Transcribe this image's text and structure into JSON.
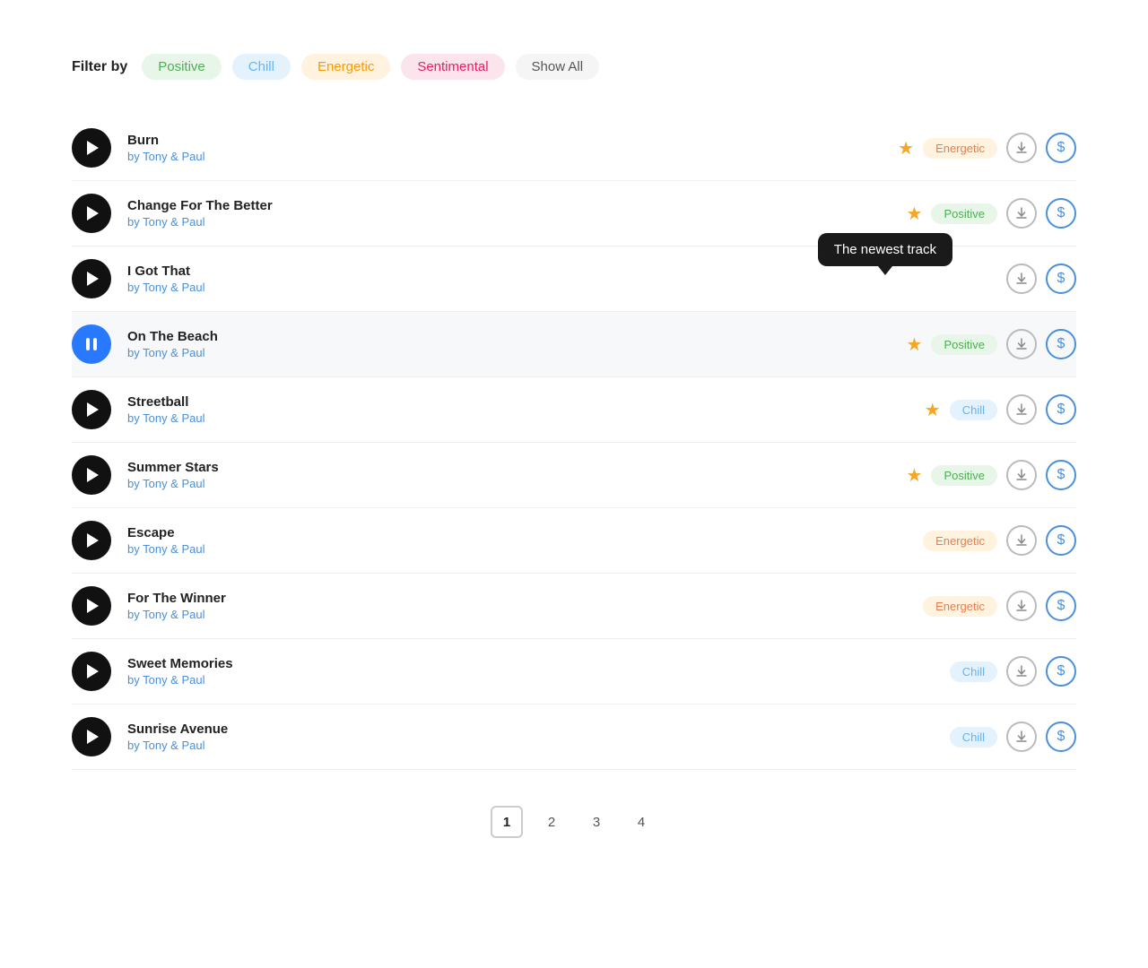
{
  "filter_bar": {
    "label": "Filter by",
    "chips": [
      {
        "id": "positive",
        "label": "Positive",
        "class": "chip-positive"
      },
      {
        "id": "chill",
        "label": "Chill",
        "class": "chip-chill"
      },
      {
        "id": "energetic",
        "label": "Energetic",
        "class": "chip-energetic"
      },
      {
        "id": "sentimental",
        "label": "Sentimental",
        "class": "chip-sentimental"
      },
      {
        "id": "showall",
        "label": "Show All",
        "class": "chip-showall"
      }
    ]
  },
  "tracks": [
    {
      "id": 1,
      "title": "Burn",
      "artist": "Tony & Paul",
      "mood": "Energetic",
      "mood_class": "badge-energetic",
      "starred": true,
      "active": false,
      "tooltip": ""
    },
    {
      "id": 2,
      "title": "Change For The Better",
      "artist": "Tony & Paul",
      "mood": "Positive",
      "mood_class": "badge-positive",
      "starred": true,
      "active": false,
      "tooltip": ""
    },
    {
      "id": 3,
      "title": "I Got That",
      "artist": "Tony & Paul",
      "mood": "",
      "mood_class": "",
      "starred": false,
      "active": false,
      "tooltip": "The newest track"
    },
    {
      "id": 4,
      "title": "On The Beach",
      "artist": "Tony & Paul",
      "mood": "Positive",
      "mood_class": "badge-positive",
      "starred": true,
      "active": true,
      "tooltip": ""
    },
    {
      "id": 5,
      "title": "Streetball",
      "artist": "Tony & Paul",
      "mood": "Chill",
      "mood_class": "badge-chill",
      "starred": true,
      "active": false,
      "tooltip": ""
    },
    {
      "id": 6,
      "title": "Summer Stars",
      "artist": "Tony & Paul",
      "mood": "Positive",
      "mood_class": "badge-positive",
      "starred": true,
      "active": false,
      "tooltip": ""
    },
    {
      "id": 7,
      "title": "Escape",
      "artist": "Tony & Paul",
      "mood": "Energetic",
      "mood_class": "badge-energetic",
      "starred": false,
      "active": false,
      "tooltip": ""
    },
    {
      "id": 8,
      "title": "For The Winner",
      "artist": "Tony & Paul",
      "mood": "Energetic",
      "mood_class": "badge-energetic",
      "starred": false,
      "active": false,
      "tooltip": ""
    },
    {
      "id": 9,
      "title": "Sweet Memories",
      "artist": "Tony & Paul",
      "mood": "Chill",
      "mood_class": "badge-chill",
      "starred": false,
      "active": false,
      "tooltip": ""
    },
    {
      "id": 10,
      "title": "Sunrise Avenue",
      "artist": "Tony & Paul",
      "mood": "Chill",
      "mood_class": "badge-chill",
      "starred": false,
      "active": false,
      "tooltip": ""
    }
  ],
  "pagination": {
    "pages": [
      "1",
      "2",
      "3",
      "4"
    ],
    "active": "1"
  },
  "labels": {
    "by": "by",
    "download": "↓",
    "dollar": "$",
    "tooltip_newest": "The newest track"
  }
}
